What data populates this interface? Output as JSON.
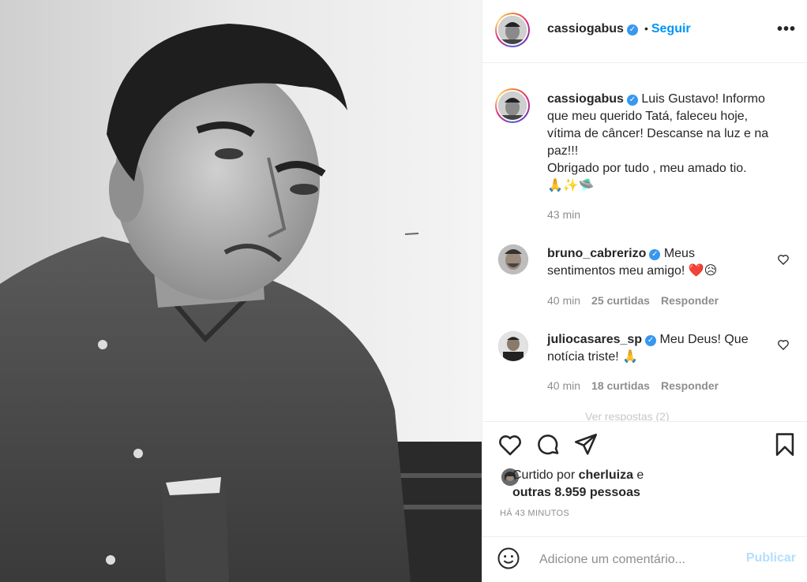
{
  "post": {
    "author": "cassiogabus",
    "verified": true,
    "follow_label": "Seguir",
    "more_label": "•••",
    "caption_lines": [
      "Luis Gustavo! Informo",
      "que meu querido Tatá, faleceu hoje,",
      "vítima de câncer! Descanse na luz e na",
      "paz!!!",
      "Obrigado por tudo , meu amado tio.",
      "🙏✨🛸"
    ],
    "caption_time": "43 min"
  },
  "comments": [
    {
      "user": "bruno_cabrerizo",
      "text_line1": "Meus",
      "text_line2": "sentimentos meu amigo! ❤️😥",
      "time": "40 min",
      "likes": "25 curtidas",
      "reply": "Responder"
    },
    {
      "user": "juliocasares_sp",
      "text_line1": "Meu Deus! Que",
      "text_line2": "notícia triste! 🙏",
      "time": "40 min",
      "likes": "18 curtidas",
      "reply": "Responder"
    }
  ],
  "hidden_replies": "Ver respostas (2)",
  "likes_summary": {
    "prefix": "Curtido por",
    "first_user": "cherluiza",
    "joiner": "e",
    "others": "outras 8.959 pessoas"
  },
  "timestamp": "HÁ 43 MINUTOS",
  "add_comment": {
    "placeholder": "Adicione um comentário...",
    "post_label": "Publicar"
  },
  "colors": {
    "accent": "#0095f6",
    "verified": "#3897f0",
    "muted": "#8e8e8e",
    "disabled_post": "#b2dffc"
  }
}
